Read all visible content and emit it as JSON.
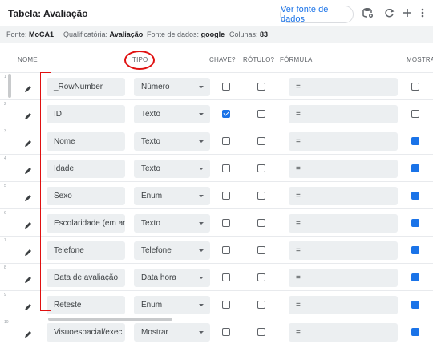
{
  "header": {
    "title": "Tabela: Avaliação",
    "view_source_label": "Ver fonte de dados"
  },
  "info": {
    "fonte_label": "Fonte:",
    "fonte_value": "MoCA1",
    "qualificatoria_label": "Qualificatória:",
    "qualificatoria_value": "Avaliação",
    "fonte_dados_label": "Fonte de dados:",
    "fonte_dados_value": "google",
    "colunas_label": "Colunas:",
    "colunas_value": "83"
  },
  "columns": {
    "nome": "NOME",
    "tipo": "TIPO",
    "chave": "CHAVE?",
    "rotulo": "RÓTULO?",
    "formula": "FÓRMULA",
    "mostrar": "MOSTRA"
  },
  "rows": [
    {
      "num": "1",
      "name": "_RowNumber",
      "type": "Número",
      "key": false,
      "label": false,
      "formula": "=",
      "show": false
    },
    {
      "num": "2",
      "name": "ID",
      "type": "Texto",
      "key": true,
      "label": false,
      "formula": "=",
      "show": false
    },
    {
      "num": "3",
      "name": "Nome",
      "type": "Texto",
      "key": false,
      "label": false,
      "formula": "=",
      "show": true
    },
    {
      "num": "4",
      "name": "Idade",
      "type": "Texto",
      "key": false,
      "label": false,
      "formula": "=",
      "show": true
    },
    {
      "num": "5",
      "name": "Sexo",
      "type": "Enum",
      "key": false,
      "label": false,
      "formula": "=",
      "show": true
    },
    {
      "num": "6",
      "name": "Escolaridade (em an",
      "type": "Texto",
      "key": false,
      "label": false,
      "formula": "=",
      "show": true
    },
    {
      "num": "7",
      "name": "Telefone",
      "type": "Telefone",
      "key": false,
      "label": false,
      "formula": "=",
      "show": true
    },
    {
      "num": "8",
      "name": "Data de avaliação",
      "type": "Data hora",
      "key": false,
      "label": false,
      "formula": "=",
      "show": true
    },
    {
      "num": "9",
      "name": "Reteste",
      "type": "Enum",
      "key": false,
      "label": false,
      "formula": "=",
      "show": true
    },
    {
      "num": "10",
      "name": "Visuoespacial/execu",
      "type": "Mostrar",
      "key": false,
      "label": false,
      "formula": "=",
      "show": true
    }
  ],
  "colors": {
    "accent": "#1a73e8",
    "annotation": "#e01010"
  }
}
